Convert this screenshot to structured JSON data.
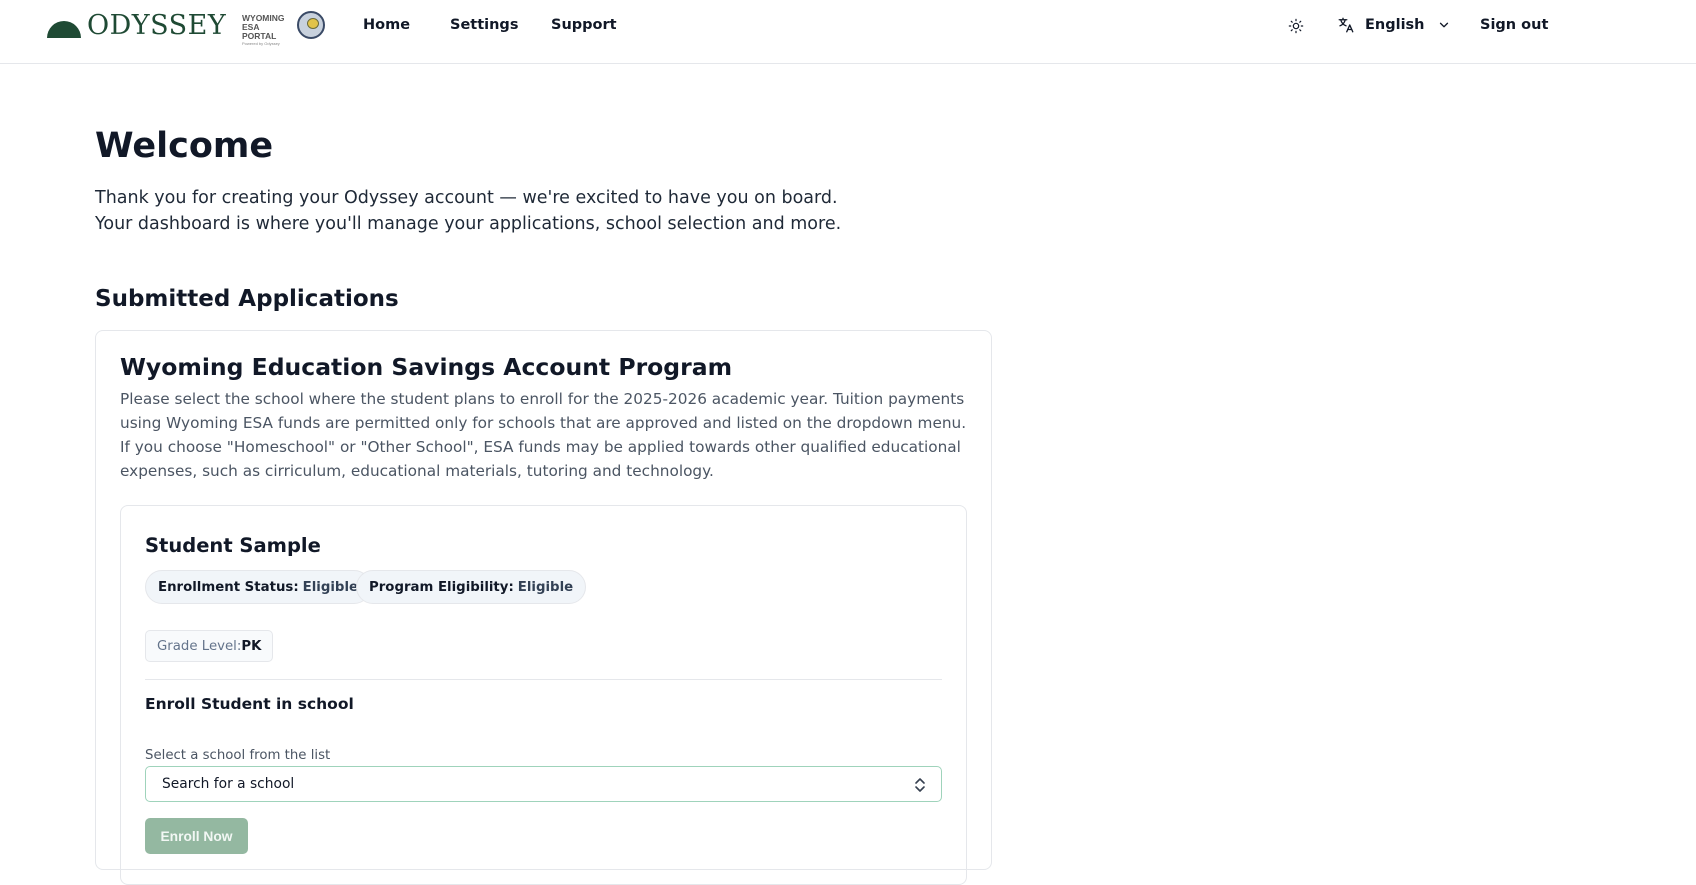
{
  "header": {
    "brand": "ODYSSEY",
    "portal_line1": "WYOMING",
    "portal_line2": "ESA PORTAL",
    "portal_line3": "Powered by Odyssey",
    "nav": {
      "home": "Home",
      "settings": "Settings",
      "support": "Support"
    },
    "theme_icon": "sun-icon",
    "language": {
      "icon": "translate-icon",
      "selected": "English"
    },
    "signout": "Sign out"
  },
  "main": {
    "welcome": "Welcome",
    "intro_line1": "Thank you for creating your Odyssey account — we're excited to have you on board.",
    "intro_line2": "Your dashboard is where you'll manage your applications, school selection and more.",
    "section_title": "Submitted Applications",
    "program": {
      "title": "Wyoming Education Savings Account Program",
      "description": "Please select the school where the student plans to enroll for the 2025-2026 academic year. Tuition payments using Wyoming ESA funds are permitted only for schools that are approved and listed on the dropdown menu. If you choose \"Homeschool\" or \"Other School\", ESA funds may be applied towards other qualified educational expenses, such as cirriculum, educational materials, tutoring and technology.",
      "student": {
        "name": "Student Sample",
        "enrollment_status_label": "Enrollment Status:",
        "enrollment_status_value": "Eligible",
        "program_eligibility_label": "Program Eligibility:",
        "program_eligibility_value": "Eligible",
        "grade_label": "Grade Level:",
        "grade_value": "PK",
        "enroll_title": "Enroll Student in school",
        "select_label": "Select a school from the list",
        "select_placeholder": "Search for a school",
        "enroll_button": "Enroll Now"
      }
    }
  },
  "colors": {
    "brand_green": "#1f4a34",
    "button_disabled": "#94b8a1",
    "select_border": "#9fd3bb"
  }
}
